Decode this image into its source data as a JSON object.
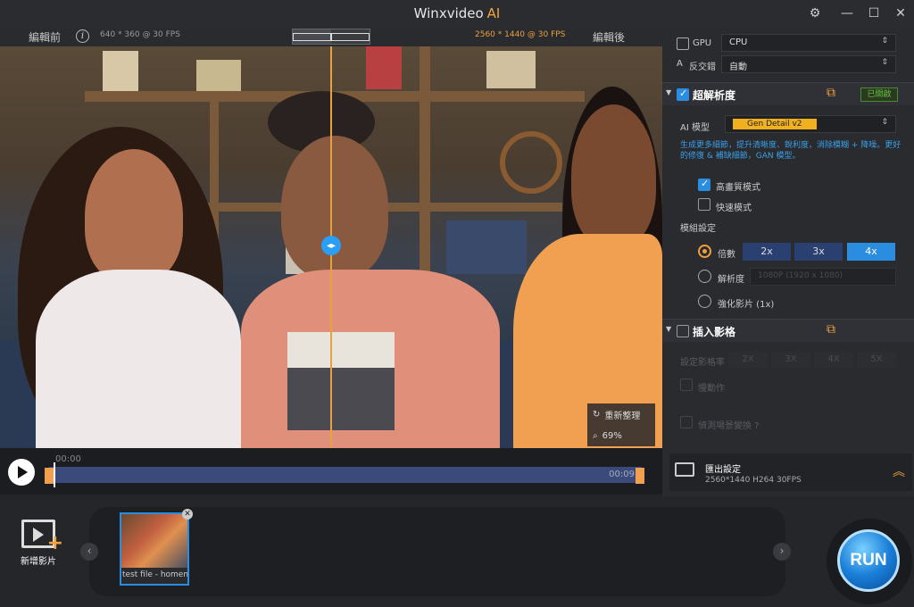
{
  "titlebar": {
    "app_name": "Winxvideo",
    "app_suffix": "AI"
  },
  "preview_header": {
    "before_label": "編輯前",
    "before_info": "640 * 360 @ 30 FPS",
    "after_info": "2560 * 1440 @ 30 FPS",
    "after_label": "編輯後"
  },
  "preview": {
    "tool_reset_label": "重新整理",
    "tool_zoom_value": "69%"
  },
  "timeline": {
    "start": "00:00",
    "end": "00:09"
  },
  "bottom": {
    "add_video_label": "新增影片",
    "thumb_name": "test file - homema",
    "run_label": "RUN"
  },
  "panel": {
    "gpu_label": "GPU",
    "gpu_value": "CPU",
    "deinterlace_label": "反交錯",
    "deinterlace_value": "自動",
    "sr_title": "超解析度",
    "sr_status": "已開啟",
    "ai_model_label": "AI 模型",
    "ai_model_value": "Gen Detail v2",
    "ai_desc": "生成更多細節，提升清晰度、銳利度，消除模糊 + 降噪。更好的修復 & 補缺細節，GAN 模型。",
    "hq_label": "高畫質模式",
    "fast_label": "快速模式",
    "module_label": "模組設定",
    "multiple_label": "倍數",
    "scale_options": [
      "2x",
      "3x",
      "4x"
    ],
    "resolution_label": "解析度",
    "resolution_value": "1080P (1920 x 1080)",
    "enhance_label": "強化影片 (1x)",
    "interp_title": "插入影格",
    "interp_rate_label": "設定影格率",
    "interp_options": [
      "2X",
      "3X",
      "4X",
      "5X"
    ],
    "slow_motion_label": "慢動作",
    "scene_detect_label": "偵測場景變換 ?",
    "export_title": "匯出設定",
    "export_info": "2560*1440  H264  30FPS"
  }
}
